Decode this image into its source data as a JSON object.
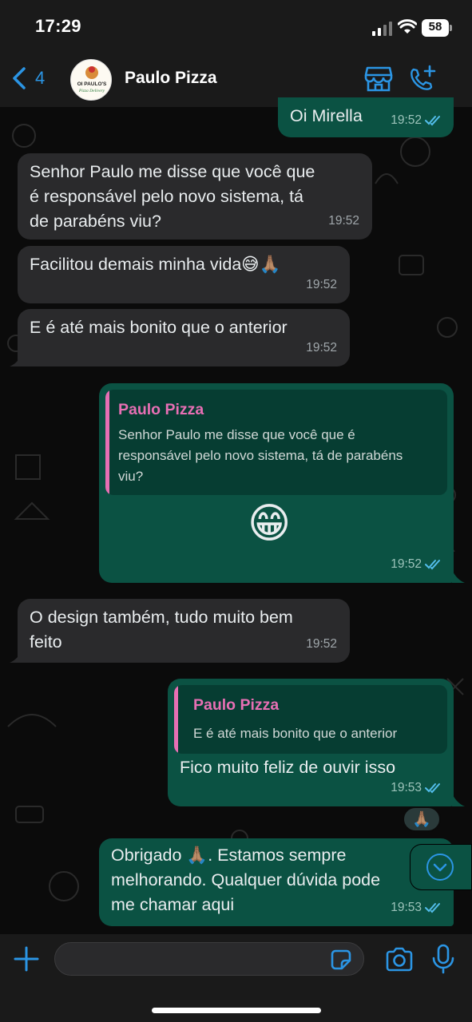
{
  "status_bar": {
    "time": "17:29",
    "battery": "58"
  },
  "header": {
    "back_count": "4",
    "contact_name": "Paulo Pizza",
    "avatar_text": [
      "OI PAULO'S",
      "Pizza Delivery"
    ]
  },
  "messages": [
    {
      "id": "m0",
      "direction": "out",
      "text": "Oi Mirella",
      "time": "19:52",
      "read": true
    },
    {
      "id": "m1",
      "direction": "in",
      "lines": [
        "Senhor Paulo me disse que você que",
        "é responsável pelo novo sistema, tá",
        "de parabéns viu?"
      ],
      "time": "19:52"
    },
    {
      "id": "m2",
      "direction": "in",
      "text": "Facilitou demais minha vida😅🙏🏽",
      "time": "19:52"
    },
    {
      "id": "m3",
      "direction": "in",
      "text": "E é até mais bonito que o anterior",
      "time": "19:52"
    },
    {
      "id": "m4",
      "direction": "out",
      "quote_author": "Paulo Pizza",
      "quote_lines": [
        "Senhor Paulo me disse que você que é",
        "responsável pelo novo sistema, tá de parabéns",
        "viu?"
      ],
      "text": "😁",
      "time": "19:52",
      "read": true
    },
    {
      "id": "m5",
      "direction": "in",
      "lines": [
        "O design também, tudo muito bem",
        "feito"
      ],
      "time": "19:52"
    },
    {
      "id": "m6",
      "direction": "out",
      "quote_author": "Paulo Pizza",
      "quote_lines": [
        "E é até mais bonito que o anterior"
      ],
      "text": "Fico muito feliz de ouvir isso",
      "time": "19:53",
      "read": true,
      "reaction": "🙏🏽"
    },
    {
      "id": "m7",
      "direction": "out",
      "lines": [
        "Obrigado 🙏🏽. Estamos sempre",
        "melhorando. Qualquer dúvida pode",
        "me chamar aqui"
      ],
      "time": "19:53",
      "read": true
    }
  ],
  "composer": {
    "placeholder": ""
  },
  "colors": {
    "accent": "#2b95e4",
    "outgoing": "#0b5243",
    "incoming": "#2a2a2c",
    "quote_author": "#e76fb4"
  },
  "icons": [
    "chevron-left-icon",
    "store-icon",
    "add-call-icon",
    "plus-icon",
    "sticker-icon",
    "camera-icon",
    "microphone-icon",
    "double-check-icon",
    "chevron-down-icon"
  ]
}
